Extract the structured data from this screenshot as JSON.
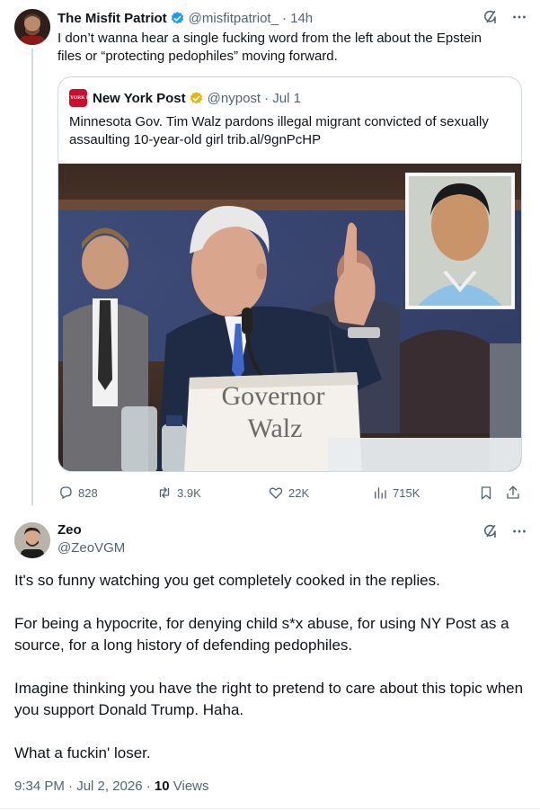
{
  "parent": {
    "name": "The Misfit Patriot",
    "handle": "@misfitpatriot_",
    "time": "· 14h",
    "text": "I don’t wanna hear a single fucking word from the left about the Epstein files or “protecting pedophiles” moving forward.",
    "quote": {
      "name": "New York Post",
      "handle": "@nypost",
      "time": "· Jul 1",
      "logo_text": "NEW YORK POST",
      "text": "Minnesota Gov. Tim Walz pardons illegal migrant convicted of sexually assaulting 10-year-old girl trib.al/9gnPcHP",
      "placard": [
        "Governor",
        "Walz"
      ]
    },
    "stats": {
      "replies": "828",
      "reposts": "3.9K",
      "likes": "22K",
      "views": "715K"
    }
  },
  "reply": {
    "name": "Zeo",
    "handle": "@ZeoVGM",
    "paragraphs": [
      "It's so funny watching you get completely cooked in the replies.",
      "For being a hypocrite, for denying child s*x abuse, for using NY Post as a source, for a long history of defending pedophiles.",
      "Imagine thinking you have the right to pretend to care about this topic when you support Donald Trump. Haha.",
      "What a fuckin' loser."
    ],
    "timestamp": "9:34 PM · Jul 2, 2026 · ",
    "views_count": "10",
    "views_label": " Views"
  },
  "colors": {
    "text": "#0f1419",
    "muted": "#536471",
    "border": "#cfd9de",
    "verified_blue": "#1d9bf0",
    "verified_gold": "#e2b719",
    "nyp_red": "#c8102e"
  },
  "icons": [
    "verified-badge-icon",
    "grok-icon",
    "more-icon",
    "reply-icon",
    "repost-icon",
    "like-icon",
    "views-icon",
    "bookmark-icon",
    "share-icon"
  ]
}
